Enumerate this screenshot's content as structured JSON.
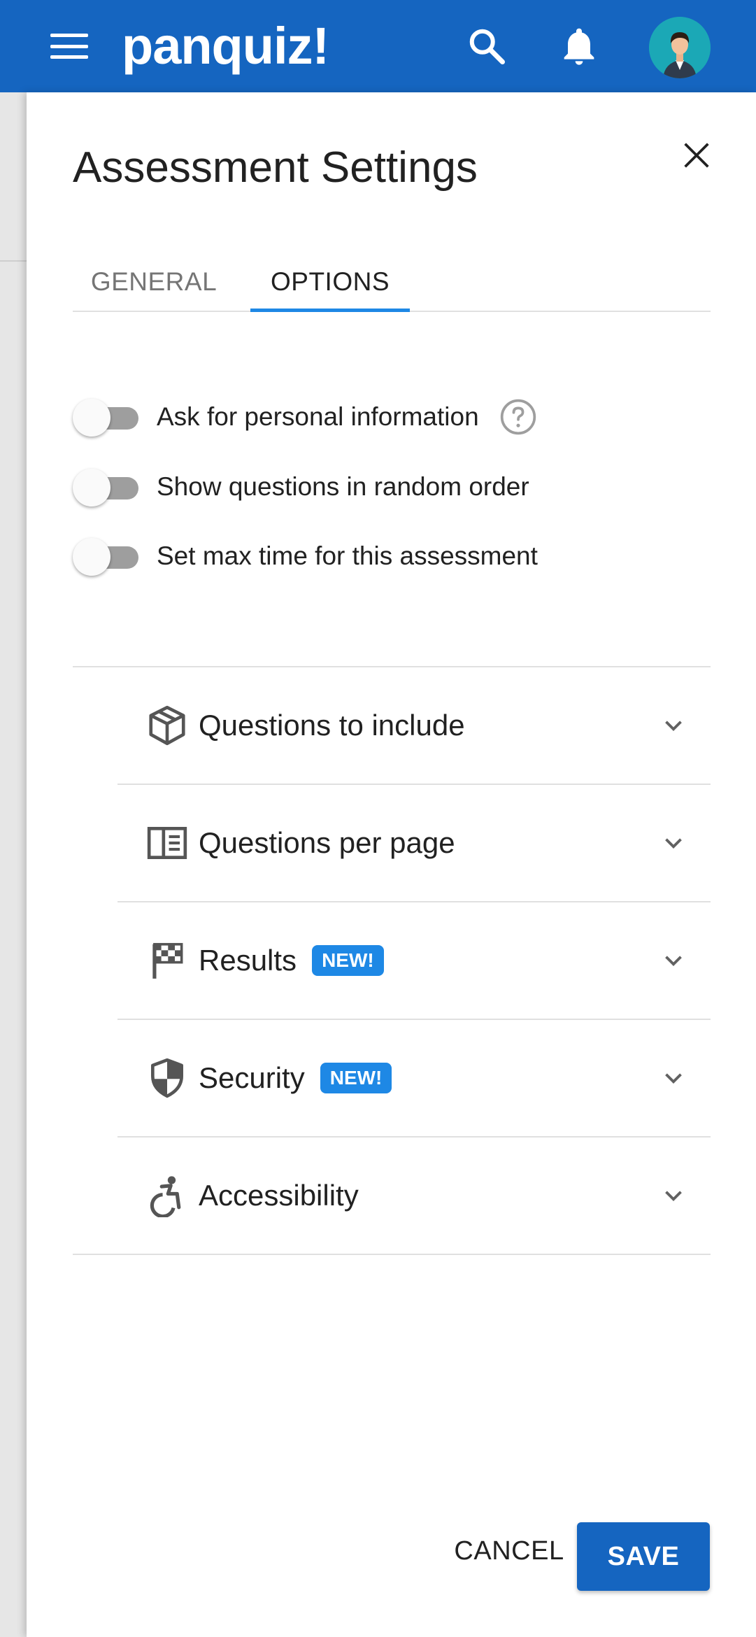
{
  "app": {
    "logo_text": "panquiz!"
  },
  "appbar": {
    "brand_color": "#1565c0"
  },
  "drawer": {
    "title": "Assessment Settings"
  },
  "tabs": [
    {
      "label": "GENERAL",
      "active": false
    },
    {
      "label": "OPTIONS",
      "active": true
    }
  ],
  "toggles": [
    {
      "label": "Ask for personal information",
      "on": false,
      "icon": "help-circle-icon"
    },
    {
      "label": "Show questions in random order",
      "on": false
    },
    {
      "label": "Set max time for this assessment",
      "on": false
    }
  ],
  "sections": [
    {
      "label": "Questions to include",
      "icon": "cube-icon",
      "badge": ""
    },
    {
      "label": "Questions per page",
      "icon": "page-layout-icon",
      "badge": ""
    },
    {
      "label": "Results",
      "icon": "checkered-flag-icon",
      "badge": "NEW!"
    },
    {
      "label": "Security",
      "icon": "shield-icon",
      "badge": "NEW!"
    },
    {
      "label": "Accessibility",
      "icon": "accessibility-icon",
      "badge": ""
    }
  ],
  "actions": {
    "cancel_label": "CANCEL",
    "save_label": "SAVE"
  },
  "colors": {
    "accent": "#1e88e5",
    "primary": "#1565c0"
  }
}
